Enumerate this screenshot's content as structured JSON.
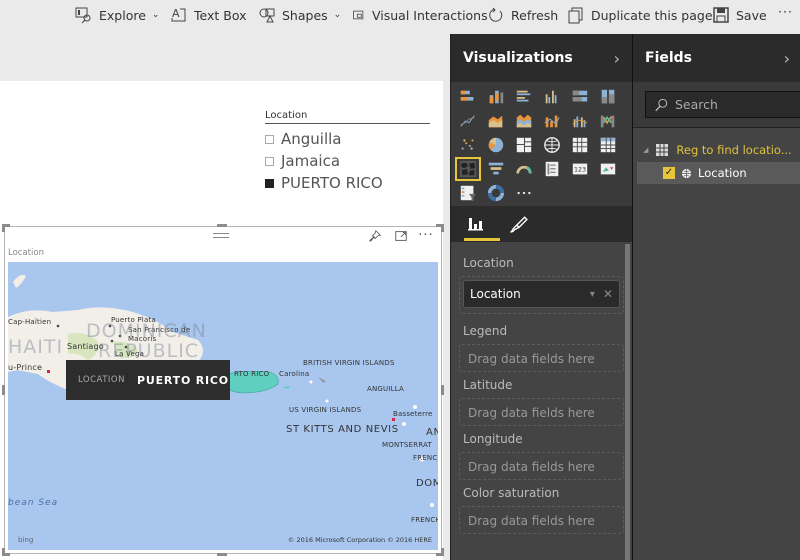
{
  "toolbar": {
    "items": [
      {
        "label": "Explore",
        "icon": "explore-icon",
        "dropdown": true
      },
      {
        "label": "Text Box",
        "icon": "text-box-icon"
      },
      {
        "label": "Shapes",
        "icon": "shapes-icon",
        "dropdown": true
      },
      {
        "label": "Visual Interactions",
        "icon": "visual-interactions-icon"
      },
      {
        "label": "Refresh",
        "icon": "refresh-icon"
      },
      {
        "label": "Duplicate this page",
        "icon": "duplicate-icon"
      },
      {
        "label": "Save",
        "icon": "save-icon"
      },
      {
        "label": "···",
        "icon": "more-icon"
      }
    ]
  },
  "slicer": {
    "title": "Location",
    "items": [
      {
        "label": "Anguilla",
        "selected": false
      },
      {
        "label": "Jamaica",
        "selected": false
      },
      {
        "label": "PUERTO RICO",
        "selected": true
      }
    ]
  },
  "map_visual": {
    "title": "Location",
    "tooltip": {
      "key": "LOCATION",
      "value": "PUERTO RICO"
    },
    "highlight_color": "#5fcfc0",
    "labels": {
      "cap_haitien": "Cap-Haïtien",
      "puerto_plata": "Puerto Plata",
      "san_francisco": "San Francisco de",
      "macoris": "Macoris",
      "dominican": "DOMINICAN",
      "republic": "REPUBLIC",
      "haiti": "HAITI",
      "santiago": "Santiago",
      "la_vega": "La Vega",
      "port_au_prince": "u-Prince",
      "puerto_rico": "RTO RICO",
      "carolina": "Carolina",
      "bvi": "BRITISH VIRGIN ISLANDS",
      "anguilla": "ANGUILLA",
      "usvi": "US VIRGIN ISLANDS",
      "basseterre": "Basseterre",
      "st_kitts": "ST KITTS AND NEVIS",
      "antigua": "AN",
      "montserrat": "MONTSERRAT",
      "french1": "FRENCH",
      "dom": "DOM",
      "french2": "FRENCH-",
      "sea": "bean Sea"
    },
    "copyright": "© 2016 Microsoft Corporation   © 2016 HERE",
    "bing": "bing"
  },
  "visualizations": {
    "title": "Visualizations",
    "icons": [
      "stacked-bar-chart",
      "stacked-column-chart",
      "clustered-bar-chart",
      "clustered-column-chart",
      "100-stacked-bar-chart",
      "100-stacked-column-chart",
      "line-chart",
      "area-chart",
      "stacked-area-chart",
      "line-and-stacked-column-chart",
      "line-and-clustered-column-chart",
      "ribbon-chart",
      "scatter-chart",
      "pie-chart",
      "treemap",
      "map",
      "table",
      "matrix",
      "filled-map",
      "funnel",
      "gauge",
      "multi-row-card",
      "card",
      "kpi",
      "slicer",
      "donut-chart",
      "more-visuals"
    ],
    "selected_icon": "filled-map",
    "wells": [
      {
        "label": "Location",
        "value": "Location"
      },
      {
        "label": "Legend",
        "placeholder": "Drag data fields here"
      },
      {
        "label": "Latitude",
        "placeholder": "Drag data fields here"
      },
      {
        "label": "Longitude",
        "placeholder": "Drag data fields here"
      },
      {
        "label": "Color saturation",
        "placeholder": "Drag data fields here"
      }
    ]
  },
  "fields": {
    "title": "Fields",
    "search_placeholder": "Search",
    "table": "Reg to find locatio...",
    "field": "Location",
    "field_checked": true
  },
  "colors": {
    "accent": "#e8c43a",
    "pane_bg": "#444444",
    "pane_header": "#2b2b2b",
    "map_water": "#a9c6ef"
  }
}
